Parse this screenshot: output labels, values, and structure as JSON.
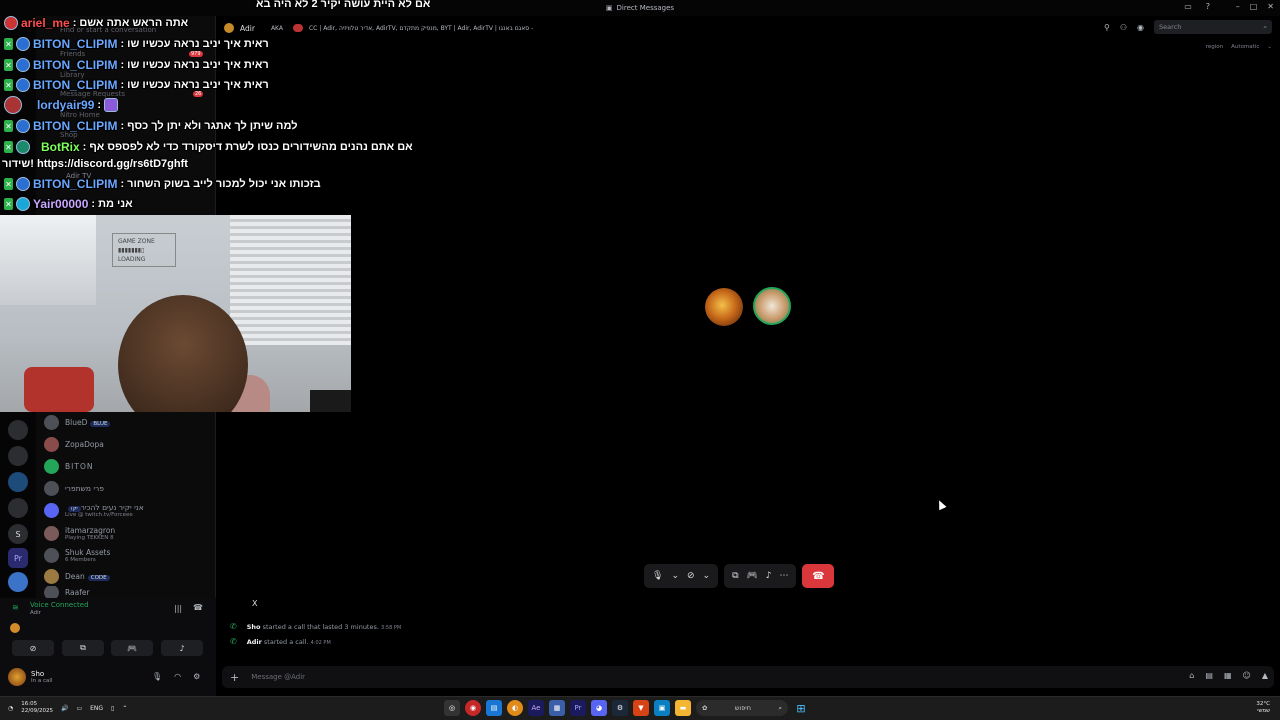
{
  "window": {
    "title": "Direct Messages"
  },
  "chat_overlay": [
    {
      "user": "",
      "message": "אם לא היית עושה יקיר 2 לא היה בא"
    },
    {
      "user": "ariel_me",
      "message": "אתה הראש אתה אשם"
    },
    {
      "user": "BITON_CLIPIM",
      "message": "ראית איך יניב נראה עכשיו שו"
    },
    {
      "user": "BITON_CLIPIM",
      "message": "ראית איך יניב נראה עכשיו שו"
    },
    {
      "user": "BITON_CLIPIM",
      "message": "ראית איך יניב נראה עכשיו שו"
    },
    {
      "user": "lordyair99",
      "message": ""
    },
    {
      "user": "BITON_CLIPIM",
      "message": "למה שיתן לך אתגר ולא יתן לך כסף"
    },
    {
      "user": "BotRix",
      "message": "אם אתם נהנים מהשידורים כנסו לשרת דיסקורד כדי לא לפספס אף"
    },
    {
      "user": "",
      "message": "שידור! https://discord.gg/rs6tD7ghft"
    },
    {
      "user": "BITON_CLIPIM",
      "message": "בזכותו אני יכול למכור לייב בשוק השחור"
    },
    {
      "user": "Yair00000",
      "message": "אני מת"
    }
  ],
  "sidebar_nav": {
    "find": "Find or start a conversation",
    "friends": "Friends",
    "friends_badge": "979",
    "library": "Library",
    "message_requests": "Message Requests",
    "requests_badge": "26",
    "nitro": "Nitro Home",
    "shop": "Shop",
    "dm_header_user": "Adir",
    "dm_header_tag": "TV"
  },
  "dm_list": [
    {
      "name": "BlueD",
      "tag": "BLUE",
      "sub": ""
    },
    {
      "name": "ZopaDopa",
      "tag": "",
      "sub": ""
    },
    {
      "name": "BITON",
      "tag": "",
      "sub": ""
    },
    {
      "name": "פרי משתפרי",
      "tag": "",
      "sub": ""
    },
    {
      "name": "אני יקיר נעים להכיר",
      "tag": "יקו",
      "sub": "Live @ twitch.tv/Forceee"
    },
    {
      "name": "itamarzagron",
      "tag": "",
      "sub": "Playing TEKKEN 8"
    },
    {
      "name": "Shuk Assets",
      "tag": "",
      "sub": "6 Members"
    },
    {
      "name": "Dean",
      "tag": "CODE",
      "sub": ""
    },
    {
      "name": "Raafer",
      "tag": "",
      "sub": ""
    }
  ],
  "call_header": {
    "name": "Adir",
    "aka": "AKA",
    "bio": "CC | Adir, אדיר טלוויזיה, AdirTV, מנפיק מתקדם, BYT | Adir, AdirTV | סאגם באנגו -"
  },
  "search": {
    "placeholder": "Search"
  },
  "region": {
    "label": "region",
    "value": "Automatic"
  },
  "messages": [
    {
      "user": "Sho",
      "text": "started a call that lasted 3 minutes.",
      "time": "3:58 PM"
    },
    {
      "user": "Adir",
      "text": "started a call.",
      "time": "4:02 PM"
    }
  ],
  "messages_header": "X",
  "composer": {
    "placeholder": "Message @Adir"
  },
  "voice_panel": {
    "title": "Voice Connected",
    "sub": "Adir"
  },
  "user_panel": {
    "name": "Sho",
    "status": "In a call"
  },
  "taskbar": {
    "time": "16:05",
    "date": "22/09/2025",
    "lang": "ENG",
    "search_text": "חיפוש",
    "weather": "32°C",
    "weather_sub": "שמשי"
  },
  "colors": {
    "accent_green": "#23a55a",
    "hangup_red": "#da373c",
    "overlay_username": "#6aa7ff"
  }
}
